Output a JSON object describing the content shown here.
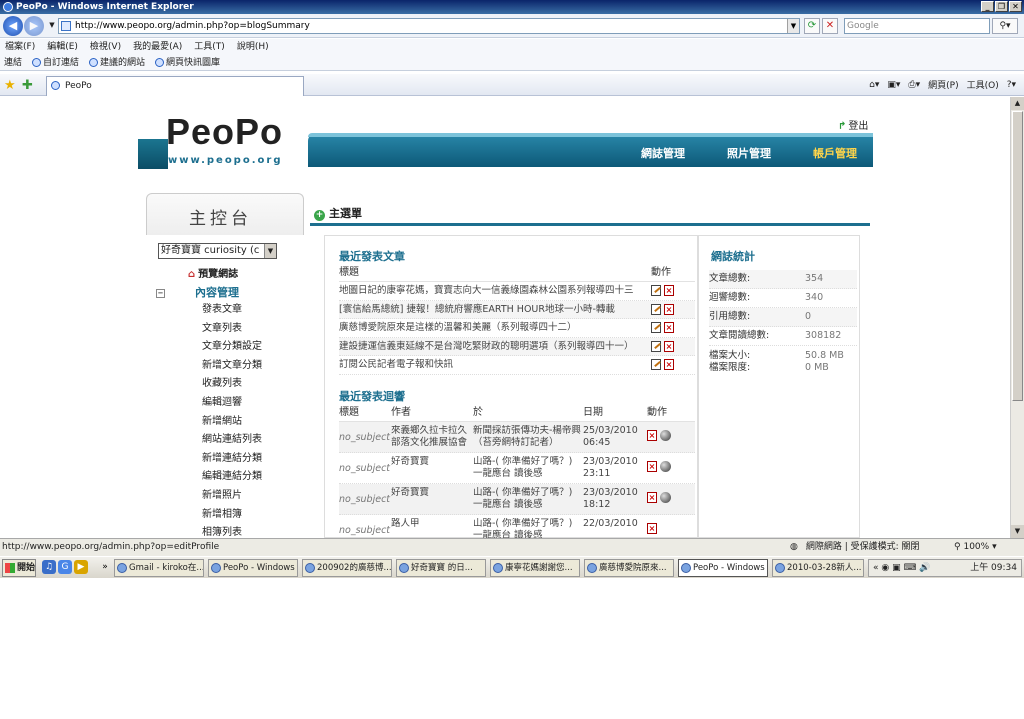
{
  "window": {
    "title": "PeoPo - Windows Internet Explorer"
  },
  "addressbar": {
    "url": "http://www.peopo.org/admin.php?op=blogSummary",
    "search_placeholder": "Google"
  },
  "menu": [
    "檔案(F)",
    "編輯(E)",
    "檢視(V)",
    "我的最愛(A)",
    "工具(T)",
    "說明(H)"
  ],
  "links": {
    "label": "連結",
    "items": [
      "自訂連結",
      "建議的網站",
      "網頁快訊圖庫"
    ]
  },
  "tab": {
    "title": "PeoPo"
  },
  "commandbar": {
    "page": "網頁(P)",
    "tools": "工具(O)"
  },
  "site": {
    "logo": "PeoPo",
    "logo_url": "www.peopo.org",
    "logout": "登出",
    "nav": [
      "網誌管理",
      "照片管理",
      "帳戶管理"
    ]
  },
  "sidebar": {
    "title": "主控台",
    "blog_select": "好奇寶寶 curiosity (c",
    "preview": "預覽網誌",
    "section": "內容管理",
    "section_toggle": "−",
    "items": [
      "發表文章",
      "文章列表",
      "文章分類設定",
      "新增文章分類",
      "收藏列表",
      "編輯迴響",
      "新增網站",
      "網站連結列表",
      "新增連結分類",
      "編輯連結分類",
      "新增照片",
      "新增相簿",
      "相簿列表"
    ]
  },
  "main": {
    "heading": "主選單",
    "recent_posts": {
      "title": "最近發表文章",
      "col_title": "標題",
      "col_action": "動作",
      "rows": [
        "地圖日記的康寧花媽，寶寶志向大一信義綠園森林公園系列報導四十三",
        "[寰信給馬總統] 捷報！總統府響應EARTH HOUR地球一小時-轉載",
        "廣慈博愛院原來是這樣的溫馨和美麗（系列報導四十二）",
        "建設捷運信義東延線不是台灣吃緊財政的聰明選項（系列報導四十一）",
        "訂閱公民記者電子報和快訊"
      ]
    },
    "recent_comments": {
      "title": "最近發表迴響",
      "cols": [
        "標題",
        "作者",
        "於",
        "日期",
        "動作"
      ],
      "rows": [
        {
          "subject": "no_subject",
          "author": "來義鄉久拉卡拉久部落文化推展協會",
          "on": "新聞採訪張傳功夫-楊帝興（苔旁網特訂記者）",
          "date": "25/03/2010",
          "time": "06:45"
        },
        {
          "subject": "no_subject",
          "author": "好奇寶寶",
          "on": "山路-( 你準備好了嗎？) 一龍應台 讀後感",
          "date": "23/03/2010",
          "time": "23:11"
        },
        {
          "subject": "no_subject",
          "author": "好奇寶寶",
          "on": "山路-( 你準備好了嗎？) 一龍應台 讀後感",
          "date": "23/03/2010",
          "time": "18:12"
        },
        {
          "subject": "no_subject",
          "author": "路人甲",
          "on": "山路-( 你準備好了嗎？) 一龍應台 讀後感",
          "date": "22/03/2010",
          "time": ""
        }
      ]
    }
  },
  "stats": {
    "title": "網誌統計",
    "rows": [
      {
        "k": "文章總數:",
        "v": "354"
      },
      {
        "k": "迴響總數:",
        "v": "340"
      },
      {
        "k": "引用總數:",
        "v": "0"
      },
      {
        "k": "文章閱讀總數:",
        "v": "308182"
      }
    ],
    "file_size_label": "檔案大小:",
    "file_size": "50.8 MB",
    "file_limit_label": "檔案限度:",
    "file_limit": "0 MB"
  },
  "statusbar": {
    "url": "http://www.peopo.org/admin.php?op=editProfile",
    "zone": "網際網路 | 受保護模式: 關閉",
    "zoom": "100%"
  },
  "taskbar": {
    "start": "開始",
    "buttons": [
      "Gmail - kiroko在...",
      "PeoPo - Windows ...",
      "200902的廣慈博...",
      "好奇寶寶 的日...",
      "康寧花媽謝謝您...",
      "廣慈博愛院原來...",
      "PeoPo - Windows ...",
      "2010-03-28新人..."
    ],
    "clock": "上午 09:34"
  }
}
